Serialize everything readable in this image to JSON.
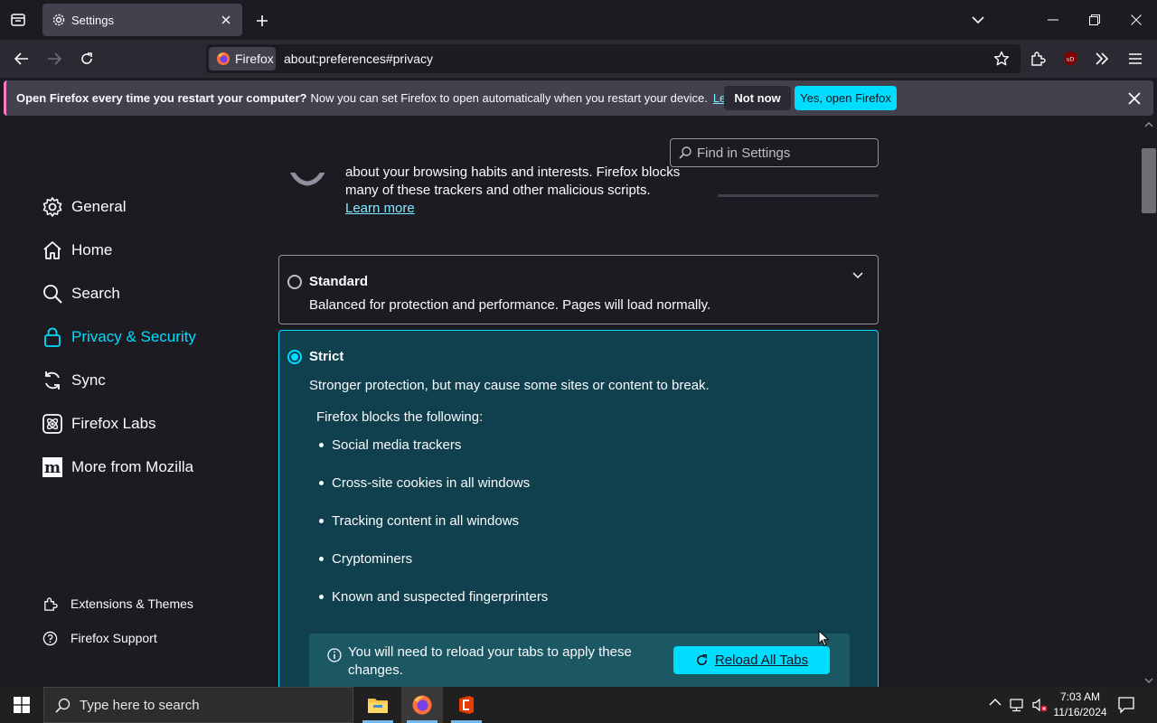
{
  "tab": {
    "title": "Settings"
  },
  "urlbar": {
    "identity_label": "Firefox",
    "url": "about:preferences#privacy"
  },
  "notice": {
    "bold": "Open Firefox every time you restart your computer?",
    "text": "Now you can set Firefox to open automatically when you restart your device.",
    "learn_more": "Learn more",
    "not_now": "Not now",
    "yes_open": "Yes, open Firefox"
  },
  "search": {
    "placeholder": "Find in Settings"
  },
  "sidebar": {
    "items": [
      {
        "label": "General",
        "icon": "gear-icon"
      },
      {
        "label": "Home",
        "icon": "home-icon"
      },
      {
        "label": "Search",
        "icon": "search-icon"
      },
      {
        "label": "Privacy & Security",
        "icon": "lock-icon",
        "selected": true
      },
      {
        "label": "Sync",
        "icon": "sync-icon"
      },
      {
        "label": "Firefox Labs",
        "icon": "atom-icon"
      },
      {
        "label": "More from Mozilla",
        "icon": "mozilla-icon"
      }
    ],
    "footer": [
      {
        "label": "Extensions & Themes",
        "icon": "puzzle-icon"
      },
      {
        "label": "Firefox Support",
        "icon": "help-icon"
      }
    ]
  },
  "tracking": {
    "partial_line1": "about your browsing habits and interests. Firefox blocks",
    "partial_line2": "many of these trackers and other malicious scripts.",
    "learn_more": "Learn more",
    "standard": {
      "title": "Standard",
      "desc": "Balanced for protection and performance. Pages will load normally.",
      "selected": false
    },
    "strict": {
      "title": "Strict",
      "desc": "Stronger protection, but may cause some sites or content to break.",
      "selected": true,
      "blocks_heading": "Firefox blocks the following:",
      "blocks": [
        "Social media trackers",
        "Cross-site cookies in all windows",
        "Tracking content in all windows",
        "Cryptominers",
        "Known and suspected fingerprinters"
      ],
      "reload_message": "You will need to reload your tabs to apply these changes.",
      "reload_button": "Reload All Tabs"
    }
  },
  "taskbar": {
    "search_placeholder": "Type here to search",
    "time": "7:03 AM",
    "date": "11/16/2024"
  },
  "colors": {
    "accent": "#00ddff",
    "strict_bg": "#10404d",
    "page_bg": "#1c1b22"
  }
}
